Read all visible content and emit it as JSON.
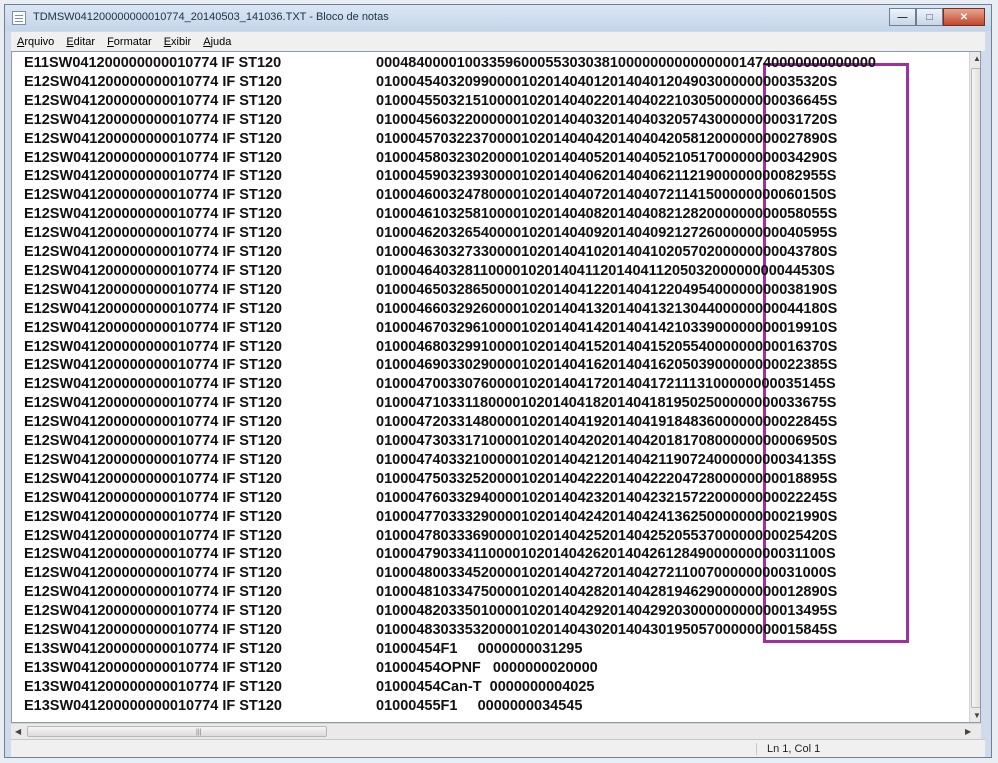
{
  "window": {
    "title": "TDMSW041200000000010774_20140503_141036.TXT - Bloco de notas",
    "minimize_glyph": "—",
    "maximize_glyph": "□",
    "close_glyph": "✕"
  },
  "menu": [
    "Arquivo",
    "Editar",
    "Formatar",
    "Exibir",
    "Ajuda"
  ],
  "editor": {
    "lines": [
      [
        "E11SW041200000000010774 IF ST120",
        "00048400001003359600055303038100000000000000014740000000000000"
      ],
      [
        "E12SW041200000000010774 IF ST120",
        "01000454032099000010201404012014040120490300000000035320S"
      ],
      [
        "E12SW041200000000010774 IF ST120",
        "01000455032151000010201404022014040221030500000000036645S"
      ],
      [
        "E12SW041200000000010774 IF ST120",
        "01000456032200000010201404032014040320574300000000031720S"
      ],
      [
        "E12SW041200000000010774 IF ST120",
        "01000457032237000010201404042014040420581200000000027890S"
      ],
      [
        "E12SW041200000000010774 IF ST120",
        "01000458032302000010201404052014040521051700000000034290S"
      ],
      [
        "E12SW041200000000010774 IF ST120",
        "01000459032393000010201404062014040621121900000000082955S"
      ],
      [
        "E12SW041200000000010774 IF ST120",
        "01000460032478000010201404072014040721141500000000060150S"
      ],
      [
        "E12SW041200000000010774 IF ST120",
        "01000461032581000010201404082014040821282000000000058055S"
      ],
      [
        "E12SW041200000000010774 IF ST120",
        "01000462032654000010201404092014040921272600000000040595S"
      ],
      [
        "E12SW041200000000010774 IF ST120",
        "01000463032733000010201404102014041020570200000000043780S"
      ],
      [
        "E12SW041200000000010774 IF ST120",
        "01000464032811000010201404112014041120503200000000044530S"
      ],
      [
        "E12SW041200000000010774 IF ST120",
        "01000465032865000010201404122014041220495400000000038190S"
      ],
      [
        "E12SW041200000000010774 IF ST120",
        "01000466032926000010201404132014041321304400000000044180S"
      ],
      [
        "E12SW041200000000010774 IF ST120",
        "01000467032961000010201404142014041421033900000000019910S"
      ],
      [
        "E12SW041200000000010774 IF ST120",
        "01000468032991000010201404152014041520554000000000016370S"
      ],
      [
        "E12SW041200000000010774 IF ST120",
        "01000469033029000010201404162014041620503900000000022385S"
      ],
      [
        "E12SW041200000000010774 IF ST120",
        "01000470033076000010201404172014041721113100000000035145S"
      ],
      [
        "E12SW041200000000010774 IF ST120",
        "01000471033118000010201404182014041819502500000000033675S"
      ],
      [
        "E12SW041200000000010774 IF ST120",
        "01000472033148000010201404192014041918483600000000022845S"
      ],
      [
        "E12SW041200000000010774 IF ST120",
        "01000473033171000010201404202014042018170800000000006950S"
      ],
      [
        "E12SW041200000000010774 IF ST120",
        "01000474033210000010201404212014042119072400000000034135S"
      ],
      [
        "E12SW041200000000010774 IF ST120",
        "01000475033252000010201404222014042220472800000000018895S"
      ],
      [
        "E12SW041200000000010774 IF ST120",
        "01000476033294000010201404232014042321572200000000022245S"
      ],
      [
        "E12SW041200000000010774 IF ST120",
        "01000477033329000010201404242014042413625000000000021990S"
      ],
      [
        "E12SW041200000000010774 IF ST120",
        "01000478033369000010201404252014042520553700000000025420S"
      ],
      [
        "E12SW041200000000010774 IF ST120",
        "01000479033411000010201404262014042612849000000000031100S"
      ],
      [
        "E12SW041200000000010774 IF ST120",
        "01000480033452000010201404272014042721100700000000031000S"
      ],
      [
        "E12SW041200000000010774 IF ST120",
        "01000481033475000010201404282014042819462900000000012890S"
      ],
      [
        "E12SW041200000000010774 IF ST120",
        "01000482033501000010201404292014042920300000000000013495S"
      ],
      [
        "E12SW041200000000010774 IF ST120",
        "01000483033532000010201404302014043019505700000000015845S"
      ],
      [
        "E13SW041200000000010774 IF ST120",
        "01000454F1     0000000031295"
      ],
      [
        "E13SW041200000000010774 IF ST120",
        "01000454OPNF   0000000020000"
      ],
      [
        "E13SW041200000000010774 IF ST120",
        "01000454Can-T  0000000004025"
      ],
      [
        "E13SW041200000000010774 IF ST120",
        "01000455F1     0000000034545"
      ]
    ]
  },
  "status": {
    "position": "Ln 1, Col 1"
  },
  "highlight_color": "#a02fa0"
}
